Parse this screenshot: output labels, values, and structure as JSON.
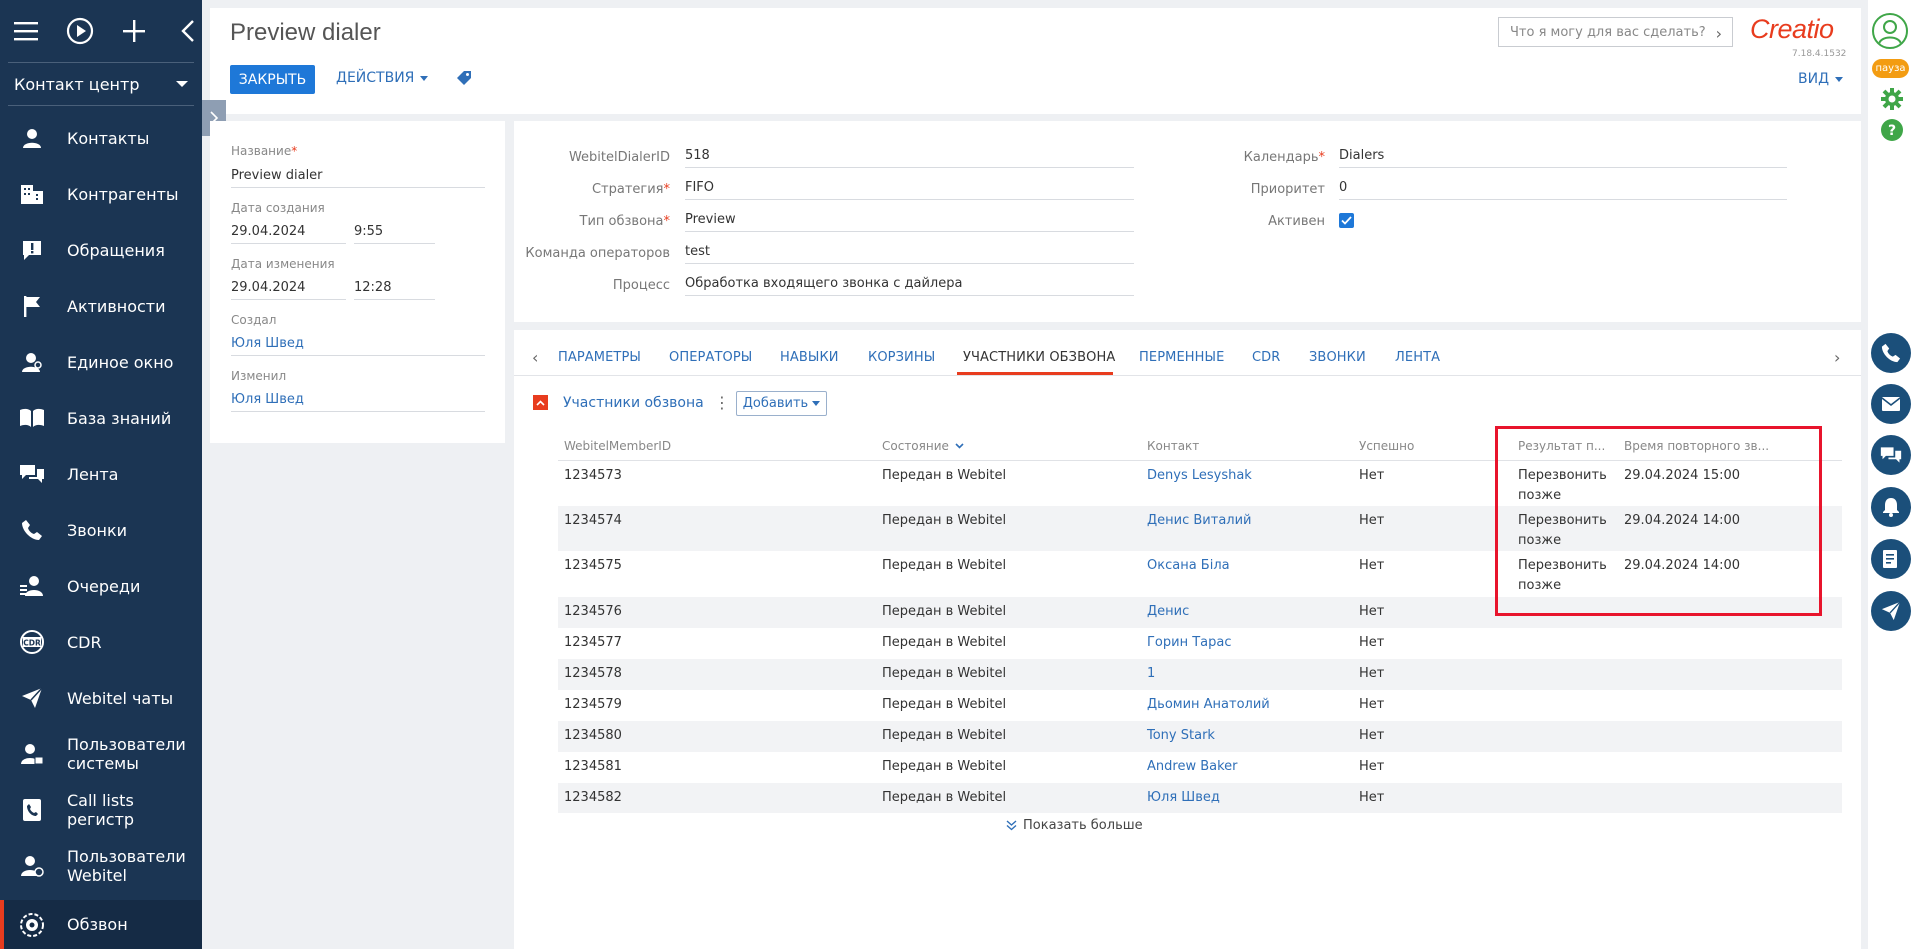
{
  "sidebar": {
    "section_select": "Контакт центр",
    "items": [
      {
        "label": "Контакты",
        "icon": "contacts-icon"
      },
      {
        "label": "Контрагенты",
        "icon": "accounts-icon"
      },
      {
        "label": "Обращения",
        "icon": "cases-icon"
      },
      {
        "label": "Активности",
        "icon": "flag-icon"
      },
      {
        "label": "Единое окно",
        "icon": "person-window-icon"
      },
      {
        "label": "База знаний",
        "icon": "book-icon"
      },
      {
        "label": "Лента",
        "icon": "chat-icon"
      },
      {
        "label": "Звонки",
        "icon": "phone-icon"
      },
      {
        "label": "Очереди",
        "icon": "queue-icon"
      },
      {
        "label": "CDR",
        "icon": "cdr-icon"
      },
      {
        "label": "Webitel чаты",
        "icon": "send-icon"
      },
      {
        "label": "Пользователи системы",
        "icon": "system-users-icon"
      },
      {
        "label": "Call lists регистр",
        "icon": "call-list-icon"
      },
      {
        "label": "Пользователи Webitel",
        "icon": "webitel-users-icon"
      },
      {
        "label": "Обзвон",
        "icon": "dialer-icon"
      }
    ]
  },
  "header": {
    "title": "Preview dialer",
    "close_label": "ЗАКРЫТЬ",
    "actions_label": "ДЕЙСТВИЯ",
    "view_label": "ВИД",
    "search_placeholder": "Что я могу для вас сделать?",
    "logo": "Creatio",
    "version": "7.18.4.1532"
  },
  "left_card": {
    "name_label": "Название",
    "name_value": "Preview dialer",
    "created_label": "Дата создания",
    "created_date": "29.04.2024",
    "created_time": "9:55",
    "modified_label": "Дата изменения",
    "modified_date": "29.04.2024",
    "modified_time": "12:28",
    "created_by_label": "Создал",
    "created_by": "Юля Швед",
    "modified_by_label": "Изменил",
    "modified_by": "Юля Швед"
  },
  "right_card": {
    "dialer_id_label": "WebitelDialerID",
    "dialer_id": "518",
    "strategy_label": "Стратегия",
    "strategy": "FIFO",
    "type_label": "Тип обзвона",
    "type": "Preview",
    "team_label": "Команда операторов",
    "team": "test",
    "process_label": "Процесс",
    "process": "Обработка входящего звонка с дайлера",
    "calendar_label": "Календарь",
    "calendar": "Dialers",
    "priority_label": "Приоритет",
    "priority": "0",
    "active_label": "Активен"
  },
  "tabs": [
    "ПАРАМЕТРЫ",
    "ОПЕРАТОРЫ",
    "НАВЫКИ",
    "КОРЗИНЫ",
    "УЧАСТНИКИ ОБЗВОНА",
    "ПЕРМЕННЫЕ",
    "CDR",
    "ЗВОНКИ",
    "ЛЕНТА"
  ],
  "section": {
    "title": "Участники обзвона",
    "add_label": "Добавить"
  },
  "grid": {
    "headers": [
      "WebitelMemberID",
      "Состояние",
      "Контакт",
      "Успешно",
      "Результат п...",
      "Время повторного зв..."
    ],
    "rows": [
      {
        "id": "1234573",
        "state": "Передан в Webitel",
        "contact": "Denys Lesyshak",
        "success": "Нет",
        "result_l1": "Перезвонить",
        "result_l2": "позже",
        "retry": "29.04.2024 15:00"
      },
      {
        "id": "1234574",
        "state": "Передан в Webitel",
        "contact": "Денис Виталий",
        "success": "Нет",
        "result_l1": "Перезвонить",
        "result_l2": "позже",
        "retry": "29.04.2024 14:00"
      },
      {
        "id": "1234575",
        "state": "Передан в Webitel",
        "contact": "Оксана Біла",
        "success": "Нет",
        "result_l1": "Перезвонить",
        "result_l2": "позже",
        "retry": "29.04.2024 14:00"
      },
      {
        "id": "1234576",
        "state": "Передан в Webitel",
        "contact": "Денис",
        "success": "Нет"
      },
      {
        "id": "1234577",
        "state": "Передан в Webitel",
        "contact": "Горин Тарас",
        "success": "Нет"
      },
      {
        "id": "1234578",
        "state": "Передан в Webitel",
        "contact": "1",
        "success": "Нет"
      },
      {
        "id": "1234579",
        "state": "Передан в Webitel",
        "contact": "Дьомин Анатолий",
        "success": "Нет"
      },
      {
        "id": "1234580",
        "state": "Передан в Webitel",
        "contact": "Tony Stark",
        "success": "Нет"
      },
      {
        "id": "1234581",
        "state": "Передан в Webitel",
        "contact": "Andrew Baker",
        "success": "Нет"
      },
      {
        "id": "1234582",
        "state": "Передан в Webitel",
        "contact": "Юля Швед",
        "success": "Нет"
      }
    ],
    "show_more": "Показать больше"
  },
  "rail": {
    "pause_label": "пауза"
  }
}
